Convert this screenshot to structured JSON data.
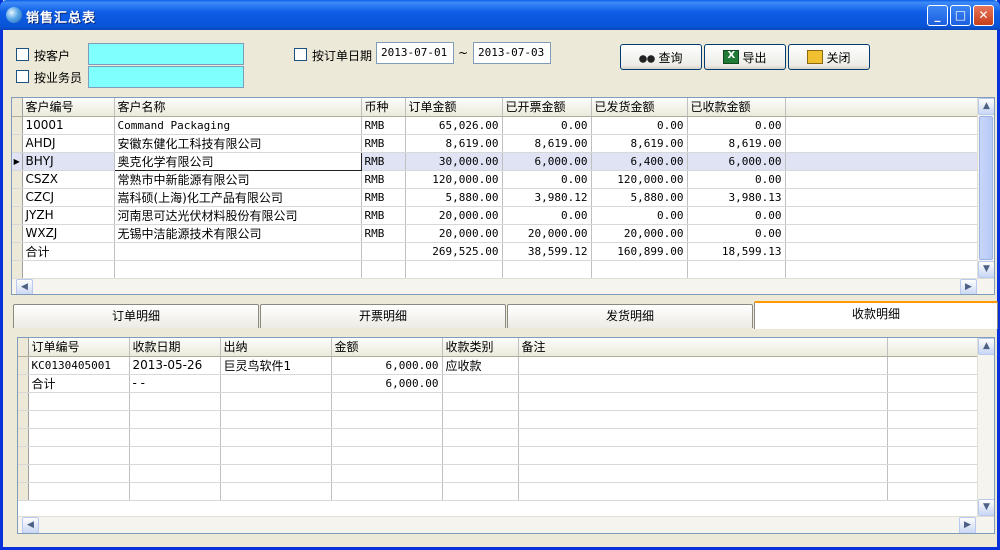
{
  "window": {
    "title": "销售汇总表"
  },
  "filters": {
    "by_customer_label": "按客户",
    "by_salesman_label": "按业务员",
    "by_order_date_label": "按订单日期",
    "date_from": "2013-07-01",
    "date_sep": "~",
    "date_to": "2013-07-03"
  },
  "toolbar": {
    "query_label": "查询",
    "export_label": "导出",
    "close_label": "关闭"
  },
  "summary_table": {
    "columns": [
      "客户编号",
      "客户名称",
      "币种",
      "订单金额",
      "已开票金额",
      "已发货金额",
      "已收款金额"
    ],
    "rows": [
      [
        "10001",
        "Command Packaging",
        "RMB",
        "65,026.00",
        "0.00",
        "0.00",
        "0.00"
      ],
      [
        "AHDJ",
        "安徽东健化工科技有限公司",
        "RMB",
        "8,619.00",
        "8,619.00",
        "8,619.00",
        "8,619.00"
      ],
      [
        "BHYJ",
        "奥克化学有限公司",
        "RMB",
        "30,000.00",
        "6,000.00",
        "6,400.00",
        "6,000.00"
      ],
      [
        "CSZX",
        "常熟市中新能源有限公司",
        "RMB",
        "120,000.00",
        "0.00",
        "120,000.00",
        "0.00"
      ],
      [
        "CZCJ",
        "嵩科硕(上海)化工产品有限公司",
        "RMB",
        "5,880.00",
        "3,980.12",
        "5,880.00",
        "3,980.13"
      ],
      [
        "JYZH",
        "河南思可达光伏材料股份有限公司",
        "RMB",
        "20,000.00",
        "0.00",
        "0.00",
        "0.00"
      ],
      [
        "WXZJ",
        "无锡中洁能源技术有限公司",
        "RMB",
        "20,000.00",
        "20,000.00",
        "20,000.00",
        "0.00"
      ],
      [
        "合计",
        "",
        "",
        "269,525.00",
        "38,599.12",
        "160,899.00",
        "18,599.13"
      ]
    ]
  },
  "tabs": [
    "订单明细",
    "开票明细",
    "发货明细",
    "收款明细"
  ],
  "detail_table": {
    "columns": [
      "订单编号",
      "收款日期",
      "出纳",
      "金额",
      "收款类别",
      "备注"
    ],
    "rows": [
      [
        "KC0130405001",
        "2013-05-26",
        "巨灵鸟软件1",
        "6,000.00",
        "应收款",
        ""
      ],
      [
        "合计",
        "-  -",
        "",
        "6,000.00",
        "",
        ""
      ]
    ]
  }
}
